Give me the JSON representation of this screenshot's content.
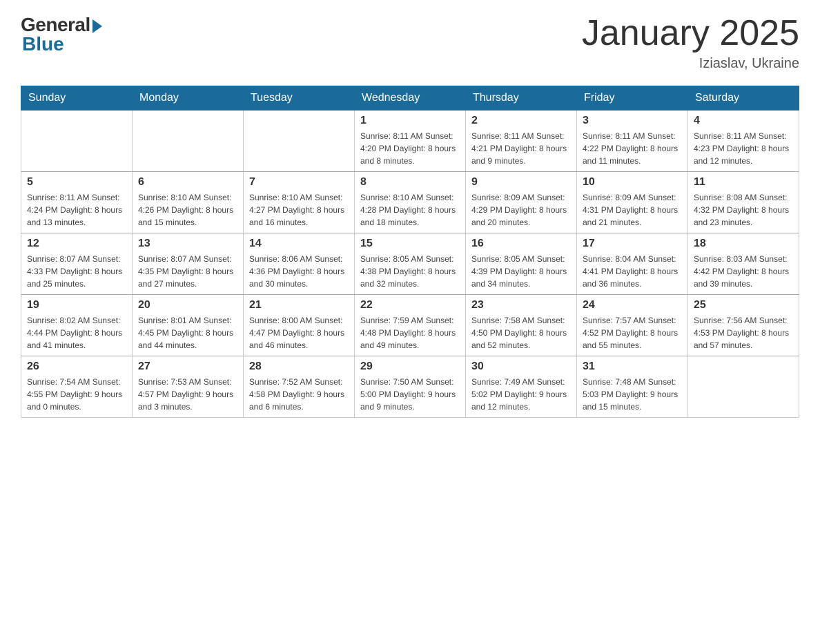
{
  "header": {
    "logo_general": "General",
    "logo_blue": "Blue",
    "month_title": "January 2025",
    "location": "Iziaslav, Ukraine"
  },
  "weekdays": [
    "Sunday",
    "Monday",
    "Tuesday",
    "Wednesday",
    "Thursday",
    "Friday",
    "Saturday"
  ],
  "weeks": [
    [
      {
        "day": "",
        "info": ""
      },
      {
        "day": "",
        "info": ""
      },
      {
        "day": "",
        "info": ""
      },
      {
        "day": "1",
        "info": "Sunrise: 8:11 AM\nSunset: 4:20 PM\nDaylight: 8 hours\nand 8 minutes."
      },
      {
        "day": "2",
        "info": "Sunrise: 8:11 AM\nSunset: 4:21 PM\nDaylight: 8 hours\nand 9 minutes."
      },
      {
        "day": "3",
        "info": "Sunrise: 8:11 AM\nSunset: 4:22 PM\nDaylight: 8 hours\nand 11 minutes."
      },
      {
        "day": "4",
        "info": "Sunrise: 8:11 AM\nSunset: 4:23 PM\nDaylight: 8 hours\nand 12 minutes."
      }
    ],
    [
      {
        "day": "5",
        "info": "Sunrise: 8:11 AM\nSunset: 4:24 PM\nDaylight: 8 hours\nand 13 minutes."
      },
      {
        "day": "6",
        "info": "Sunrise: 8:10 AM\nSunset: 4:26 PM\nDaylight: 8 hours\nand 15 minutes."
      },
      {
        "day": "7",
        "info": "Sunrise: 8:10 AM\nSunset: 4:27 PM\nDaylight: 8 hours\nand 16 minutes."
      },
      {
        "day": "8",
        "info": "Sunrise: 8:10 AM\nSunset: 4:28 PM\nDaylight: 8 hours\nand 18 minutes."
      },
      {
        "day": "9",
        "info": "Sunrise: 8:09 AM\nSunset: 4:29 PM\nDaylight: 8 hours\nand 20 minutes."
      },
      {
        "day": "10",
        "info": "Sunrise: 8:09 AM\nSunset: 4:31 PM\nDaylight: 8 hours\nand 21 minutes."
      },
      {
        "day": "11",
        "info": "Sunrise: 8:08 AM\nSunset: 4:32 PM\nDaylight: 8 hours\nand 23 minutes."
      }
    ],
    [
      {
        "day": "12",
        "info": "Sunrise: 8:07 AM\nSunset: 4:33 PM\nDaylight: 8 hours\nand 25 minutes."
      },
      {
        "day": "13",
        "info": "Sunrise: 8:07 AM\nSunset: 4:35 PM\nDaylight: 8 hours\nand 27 minutes."
      },
      {
        "day": "14",
        "info": "Sunrise: 8:06 AM\nSunset: 4:36 PM\nDaylight: 8 hours\nand 30 minutes."
      },
      {
        "day": "15",
        "info": "Sunrise: 8:05 AM\nSunset: 4:38 PM\nDaylight: 8 hours\nand 32 minutes."
      },
      {
        "day": "16",
        "info": "Sunrise: 8:05 AM\nSunset: 4:39 PM\nDaylight: 8 hours\nand 34 minutes."
      },
      {
        "day": "17",
        "info": "Sunrise: 8:04 AM\nSunset: 4:41 PM\nDaylight: 8 hours\nand 36 minutes."
      },
      {
        "day": "18",
        "info": "Sunrise: 8:03 AM\nSunset: 4:42 PM\nDaylight: 8 hours\nand 39 minutes."
      }
    ],
    [
      {
        "day": "19",
        "info": "Sunrise: 8:02 AM\nSunset: 4:44 PM\nDaylight: 8 hours\nand 41 minutes."
      },
      {
        "day": "20",
        "info": "Sunrise: 8:01 AM\nSunset: 4:45 PM\nDaylight: 8 hours\nand 44 minutes."
      },
      {
        "day": "21",
        "info": "Sunrise: 8:00 AM\nSunset: 4:47 PM\nDaylight: 8 hours\nand 46 minutes."
      },
      {
        "day": "22",
        "info": "Sunrise: 7:59 AM\nSunset: 4:48 PM\nDaylight: 8 hours\nand 49 minutes."
      },
      {
        "day": "23",
        "info": "Sunrise: 7:58 AM\nSunset: 4:50 PM\nDaylight: 8 hours\nand 52 minutes."
      },
      {
        "day": "24",
        "info": "Sunrise: 7:57 AM\nSunset: 4:52 PM\nDaylight: 8 hours\nand 55 minutes."
      },
      {
        "day": "25",
        "info": "Sunrise: 7:56 AM\nSunset: 4:53 PM\nDaylight: 8 hours\nand 57 minutes."
      }
    ],
    [
      {
        "day": "26",
        "info": "Sunrise: 7:54 AM\nSunset: 4:55 PM\nDaylight: 9 hours\nand 0 minutes."
      },
      {
        "day": "27",
        "info": "Sunrise: 7:53 AM\nSunset: 4:57 PM\nDaylight: 9 hours\nand 3 minutes."
      },
      {
        "day": "28",
        "info": "Sunrise: 7:52 AM\nSunset: 4:58 PM\nDaylight: 9 hours\nand 6 minutes."
      },
      {
        "day": "29",
        "info": "Sunrise: 7:50 AM\nSunset: 5:00 PM\nDaylight: 9 hours\nand 9 minutes."
      },
      {
        "day": "30",
        "info": "Sunrise: 7:49 AM\nSunset: 5:02 PM\nDaylight: 9 hours\nand 12 minutes."
      },
      {
        "day": "31",
        "info": "Sunrise: 7:48 AM\nSunset: 5:03 PM\nDaylight: 9 hours\nand 15 minutes."
      },
      {
        "day": "",
        "info": ""
      }
    ]
  ]
}
